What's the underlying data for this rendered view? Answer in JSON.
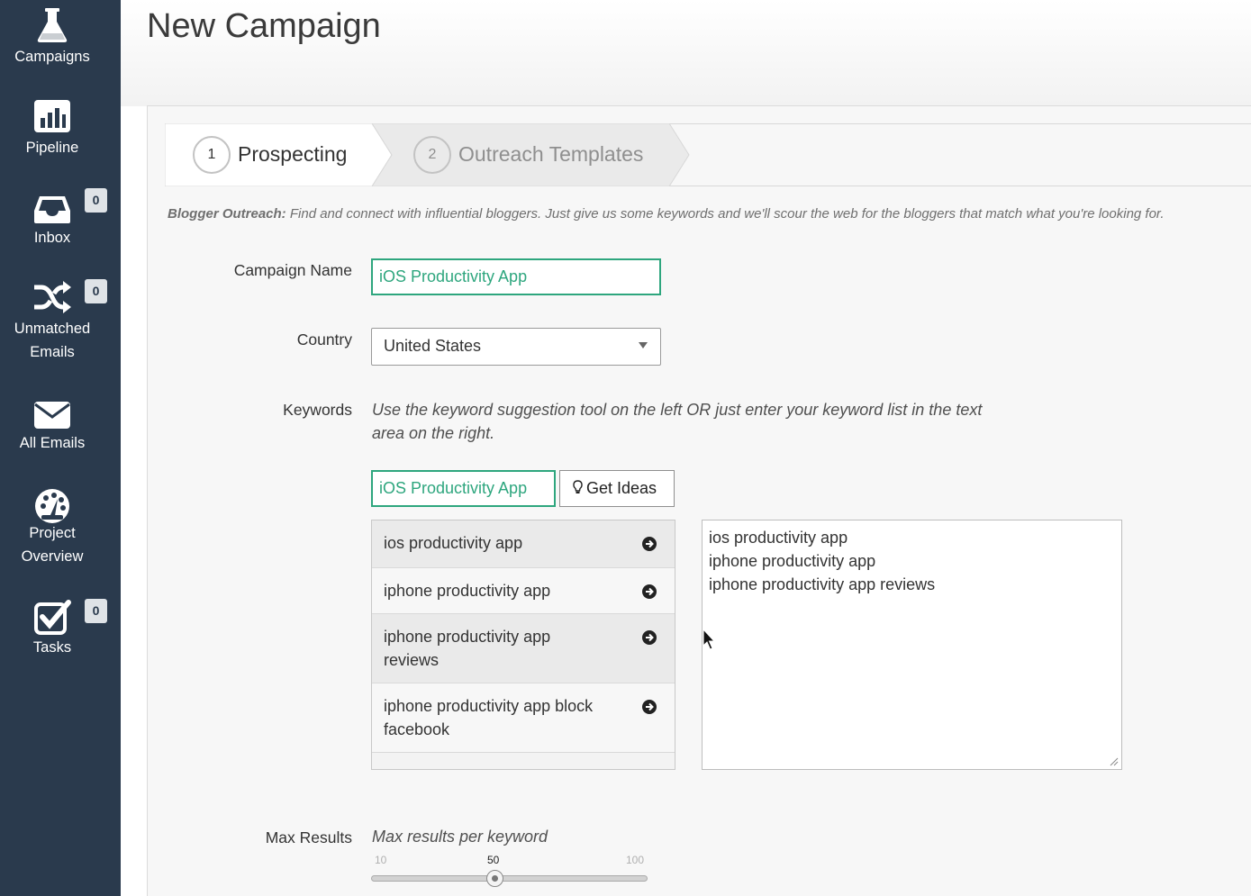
{
  "sidebar": {
    "items": [
      {
        "label": "Campaigns",
        "icon": "flask-icon"
      },
      {
        "label": "Pipeline",
        "icon": "bar-chart-icon"
      },
      {
        "label": "Inbox",
        "icon": "inbox-icon",
        "badge": "0"
      },
      {
        "label": "Unmatched",
        "label2": "Emails",
        "icon": "shuffle-icon",
        "badge": "0"
      },
      {
        "label": "All Emails",
        "icon": "envelope-icon"
      },
      {
        "label": "Project",
        "label2": "Overview",
        "icon": "dashboard-icon"
      },
      {
        "label": "Tasks",
        "icon": "checkbox-icon",
        "badge": "0"
      }
    ]
  },
  "header": {
    "title": "New Campaign"
  },
  "steps": [
    {
      "number": "1",
      "label": "Prospecting",
      "active": true
    },
    {
      "number": "2",
      "label": "Outreach Templates",
      "active": false
    }
  ],
  "intro": {
    "bold": "Blogger Outreach:",
    "text": " Find and connect with influential bloggers. Just give us some keywords and we'll scour the web for the bloggers that match what you're looking for."
  },
  "form": {
    "campaign_name_label": "Campaign Name",
    "campaign_name_value": "iOS Productivity App",
    "country_label": "Country",
    "country_value": "United States",
    "keywords_label": "Keywords",
    "keywords_help": "Use the keyword suggestion tool on the left OR just enter your keyword list in the text area on the right.",
    "keyword_search_value": "iOS Productivity App",
    "get_ideas_label": "Get Ideas",
    "suggestions": [
      "ios productivity app",
      "iphone productivity app",
      "iphone productivity app reviews",
      "iphone productivity app block facebook"
    ],
    "keyword_list": [
      "ios productivity app",
      "iphone productivity app",
      "iphone productivity app reviews"
    ],
    "max_results_label": "Max Results",
    "max_results_help": "Max results per keyword",
    "slider": {
      "min": "10",
      "value": "50",
      "max": "100"
    }
  },
  "colors": {
    "sidebar": "#2a3a4d",
    "accent": "#2ea67e"
  }
}
